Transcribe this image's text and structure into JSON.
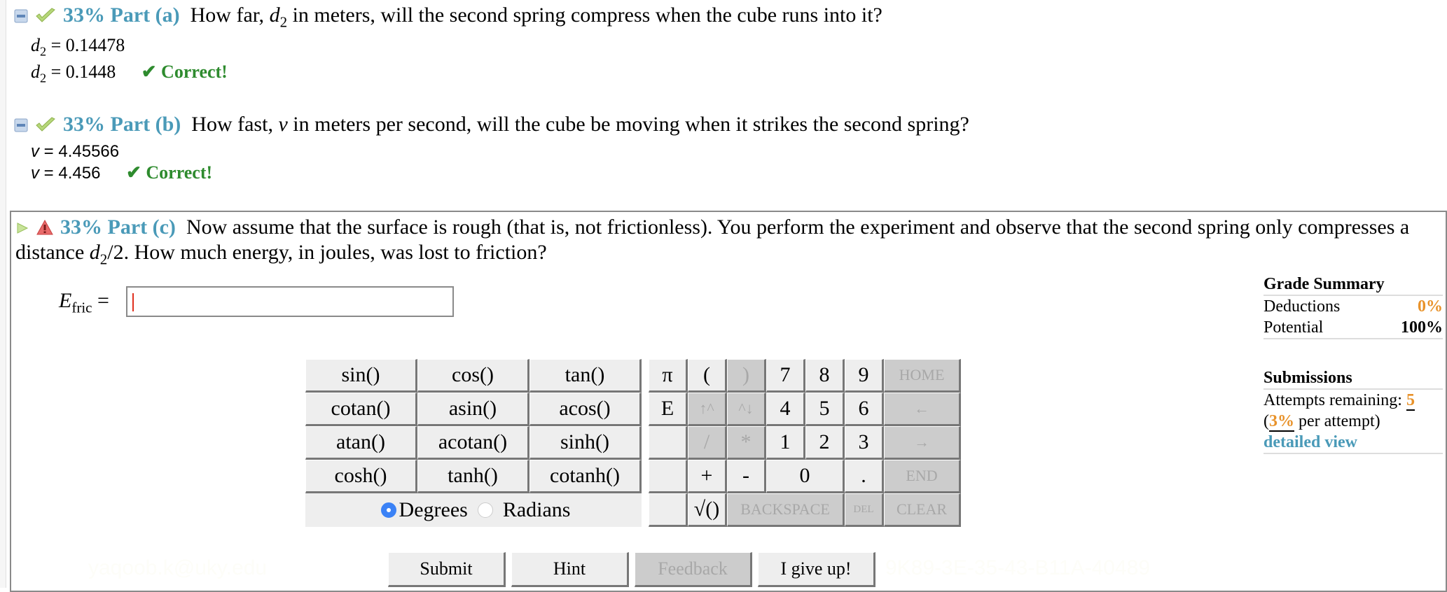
{
  "parts": [
    {
      "id": "a",
      "percent": "33%",
      "label": "Part (a)",
      "status": "correct",
      "question_pre": "How far, ",
      "question_var": "d",
      "question_sub": "2",
      "question_post": " in meters, will the second spring compress when the cube runs into it?",
      "answers": [
        {
          "var": "d",
          "sub": "2",
          "value": "= 0.14478"
        },
        {
          "var": "d",
          "sub": "2",
          "value": "= 0.1448",
          "feedback": "✔ Correct!"
        }
      ]
    },
    {
      "id": "b",
      "percent": "33%",
      "label": "Part (b)",
      "status": "correct",
      "question_pre": "How fast, ",
      "question_var": "v",
      "question_post": " in meters per second, will the cube be moving when it strikes the second spring?",
      "answers": [
        {
          "var": "v",
          "value": "= 4.45566"
        },
        {
          "var": "v",
          "value": "= 4.456",
          "feedback": "✔ Correct!"
        }
      ]
    },
    {
      "id": "c",
      "percent": "33%",
      "label": "Part (c)",
      "status": "warning",
      "question_pre": "Now assume that the surface is rough (that is, not frictionless). You perform the experiment and observe that the second spring only compresses a distance ",
      "question_var": "d",
      "question_sub": "2",
      "question_post": "/2. How much energy, in joules, was lost to friction?",
      "input_label_var": "E",
      "input_label_sub": "fric",
      "input_label_eq": "=",
      "input_value": ""
    }
  ],
  "keypad": {
    "functions": [
      "sin()",
      "cos()",
      "tan()",
      "cotan()",
      "asin()",
      "acos()",
      "atan()",
      "acotan()",
      "sinh()",
      "cosh()",
      "tanh()",
      "cotanh()"
    ],
    "angle_mode": {
      "options": [
        "Degrees",
        "Radians"
      ],
      "selected": "Degrees"
    },
    "keys": {
      "pi": "π",
      "e": "E",
      "lparen": "(",
      "rparen": ")",
      "up_caret": "↑^",
      "caret_down": "^↓",
      "divide": "/",
      "multiply": "*",
      "plus": "+",
      "minus": "-",
      "sqrt": "√()",
      "n7": "7",
      "n8": "8",
      "n9": "9",
      "n4": "4",
      "n5": "5",
      "n6": "6",
      "n1": "1",
      "n2": "2",
      "n3": "3",
      "n0": "0",
      "dot": ".",
      "home": "HOME",
      "left": "←",
      "right": "→",
      "end": "END",
      "backspace": "BACKSPACE",
      "del": "DEL",
      "clear": "CLEAR"
    }
  },
  "actions": {
    "submit": "Submit",
    "hint": "Hint",
    "feedback": "Feedback",
    "give_up": "I give up!"
  },
  "grade_summary": {
    "title": "Grade Summary",
    "deductions_label": "Deductions",
    "deductions_value": "0%",
    "potential_label": "Potential",
    "potential_value": "100%",
    "submissions_title": "Submissions",
    "attempts_label": "Attempts remaining:",
    "attempts_value": "5",
    "per_attempt_open": "(",
    "per_attempt_value": "3%",
    "per_attempt_text": " per attempt)",
    "detailed_view": "detailed view"
  },
  "watermarks": [
    "yaqoob.k@uky.edu",
    "9K89-3E-35-43-B11A-40489"
  ],
  "colors": {
    "accent": "#4a9ab8",
    "correct": "#2e8b2e",
    "orange": "#e8922a"
  }
}
